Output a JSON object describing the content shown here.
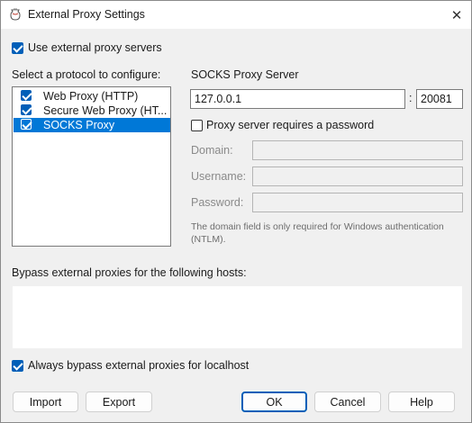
{
  "window": {
    "title": "External Proxy Settings",
    "close_glyph": "✕"
  },
  "use_external": {
    "label": "Use external proxy servers",
    "checked": true
  },
  "protocols": {
    "heading": "Select a protocol to configure:",
    "items": [
      {
        "label": "Web Proxy (HTTP)",
        "checked": true,
        "selected": false
      },
      {
        "label": "Secure Web Proxy (HT...",
        "checked": true,
        "selected": false
      },
      {
        "label": "SOCKS Proxy",
        "checked": true,
        "selected": true
      }
    ]
  },
  "server": {
    "heading": "SOCKS Proxy Server",
    "host": "127.0.0.1",
    "separator": ":",
    "port": "20081",
    "password_required_label": "Proxy server requires a password",
    "password_required": false,
    "domain_label": "Domain:",
    "domain_value": "",
    "username_label": "Username:",
    "username_value": "",
    "password_label": "Password:",
    "password_value": "",
    "note": "The domain field is only required for Windows authentication (NTLM)."
  },
  "bypass": {
    "heading": "Bypass external proxies for the following hosts:",
    "hosts": "",
    "localhost_label": "Always bypass external proxies for localhost",
    "localhost_checked": true
  },
  "buttons": {
    "import": "Import",
    "export": "Export",
    "ok": "OK",
    "cancel": "Cancel",
    "help": "Help"
  },
  "colors": {
    "accent": "#005fb8",
    "selection": "#0078d7",
    "window_bg": "#f0f0f0"
  },
  "icons": {
    "app": "charles-jug-icon",
    "close": "close-icon"
  }
}
